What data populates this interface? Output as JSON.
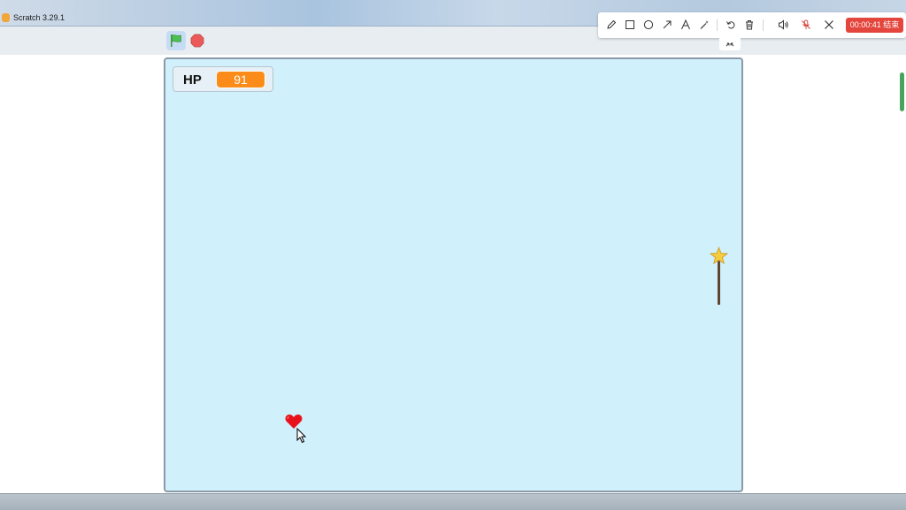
{
  "window": {
    "title": "Scratch 3.29.1"
  },
  "controls": {
    "green_flag": "green-flag-icon",
    "stop": "stop-icon",
    "flag_color": "#4cbf56",
    "stop_color": "#ec5959"
  },
  "recorder": {
    "tools": [
      "pencil-icon",
      "rectangle-icon",
      "circle-icon",
      "arrow-icon",
      "text-icon",
      "magic-wand-icon",
      "undo-icon",
      "trash-icon",
      "speaker-icon",
      "mic-muted-icon",
      "close-icon"
    ],
    "timer": "00:00:41 结束",
    "timer_color": "#e4453c"
  },
  "stage": {
    "background_color": "#d0f1fb",
    "monitor": {
      "label": "HP",
      "value": "91",
      "value_color": "#fb8c1a"
    },
    "sprites": [
      "heart-sprite",
      "wand-sprite"
    ]
  }
}
